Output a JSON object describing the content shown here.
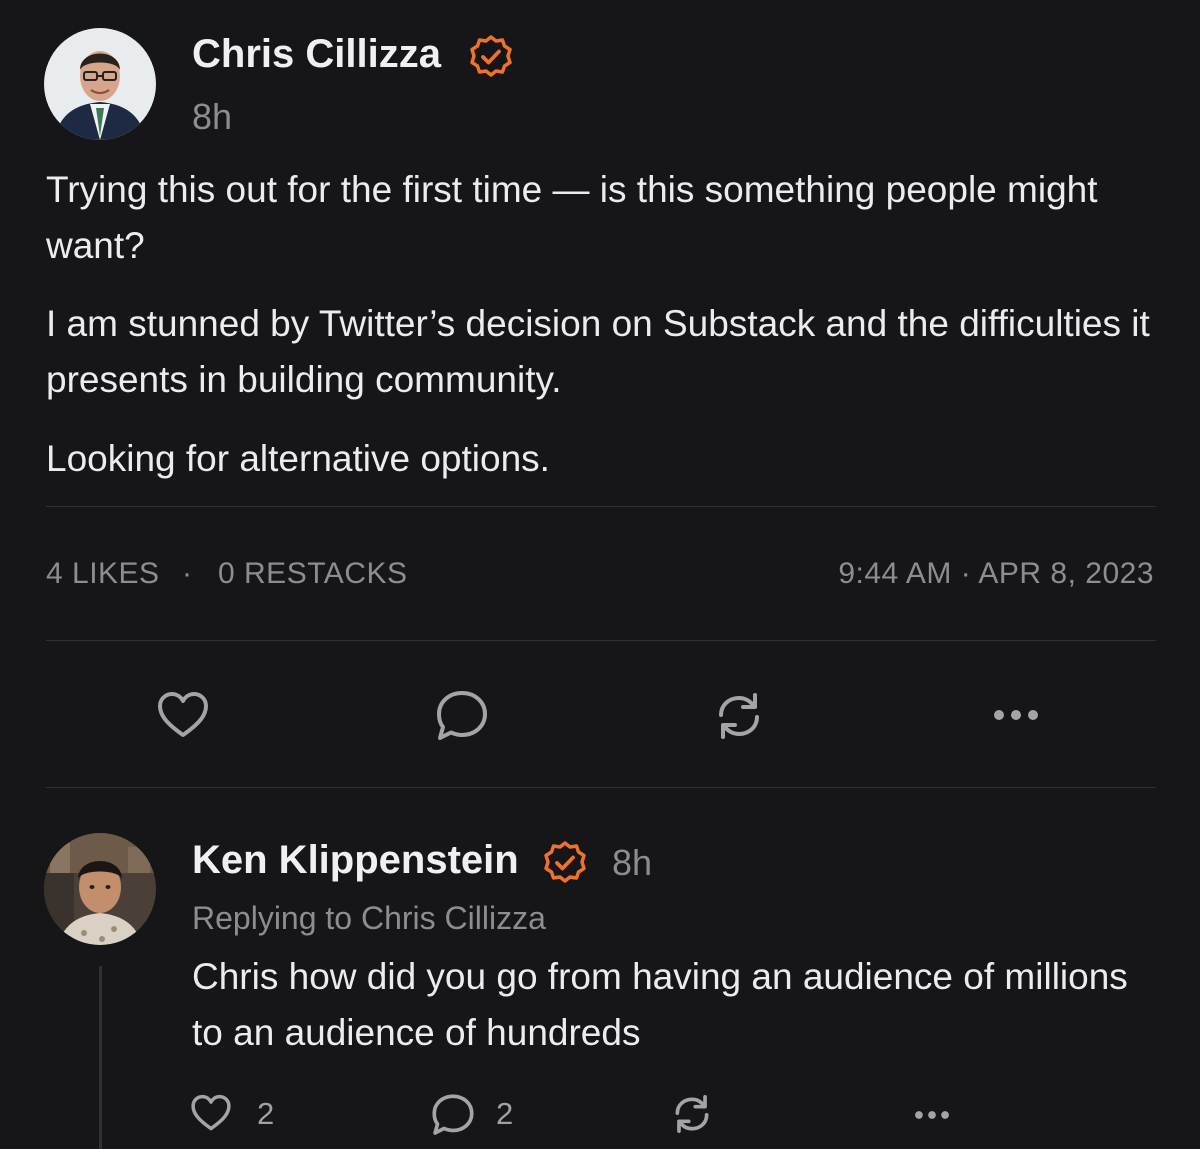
{
  "post": {
    "author": "Chris Cillizza",
    "verified_icon": "verified-badge-icon",
    "time_ago": "8h",
    "paragraphs": [
      "Trying this out for the first time — is this something people might want?",
      "I am stunned by Twitter’s decision on Substack and the difficulties it presents in building community.",
      "Looking for alternative options."
    ],
    "likes": "4 LIKES",
    "separator": "·",
    "restacks": "0 RESTACKS",
    "timestamp": "9:44 AM · APR 8, 2023"
  },
  "actions": {
    "like_icon": "heart-icon",
    "comment_icon": "comment-icon",
    "restack_icon": "restack-icon",
    "more_icon": "more-icon"
  },
  "reply": {
    "author": "Ken Klippenstein",
    "time_ago": "8h",
    "replying_to": "Replying to Chris Cillizza",
    "text": "Chris how did you go from having an audience of millions to an audience of hundreds",
    "likes_count": "2",
    "comments_count": "2"
  },
  "colors": {
    "background": "#161619",
    "accent": "#f2712a",
    "text": "#ededee",
    "muted": "#8c8c92"
  }
}
